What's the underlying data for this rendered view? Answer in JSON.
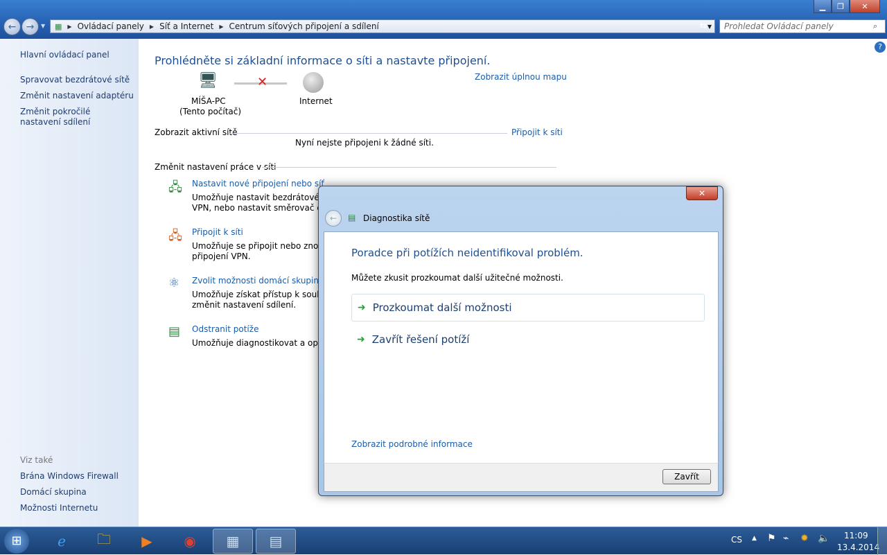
{
  "window": {
    "minimize": "▁",
    "maximize": "❐",
    "close": "✕"
  },
  "address": {
    "crumbs": [
      "Ovládací panely",
      "Síť a Internet",
      "Centrum síťových připojení a sdílení"
    ],
    "search_placeholder": "Prohledat Ovládací panely"
  },
  "sidebar": {
    "items": [
      "Hlavní ovládací panel",
      "Spravovat bezdrátové sítě",
      "Změnit nastavení adaptéru",
      "Změnit pokročilé nastavení sdílení"
    ],
    "see_also_title": "Viz také",
    "see_also": [
      "Brána Windows Firewall",
      "Domácí skupina",
      "Možnosti Internetu"
    ]
  },
  "main": {
    "title": "Prohlédněte si základní informace o síti a nastavte připojení.",
    "full_map": "Zobrazit úplnou mapu",
    "pc_name": "MÍŠA-PC",
    "pc_sub": "(Tento počítač)",
    "internet": "Internet",
    "active_title": "Zobrazit aktivní sítě",
    "connect": "Připojit k síti",
    "no_network": "Nyní nejste připojeni k žádné síti.",
    "change_title": "Změnit nastavení práce v síti",
    "tasks": [
      {
        "title": "Nastavit nové připojení nebo síť",
        "desc1": "Umožňuje nastavit bezdrátové, širo",
        "desc2": "VPN, nebo nastavit směrovač či přís"
      },
      {
        "title": "Připojit k síti",
        "desc1": "Umožňuje se připojit nebo znovu p",
        "desc2": "připojení VPN."
      },
      {
        "title": "Zvolit možnosti domácí skupiny a",
        "desc1": "Umožňuje získat přístup k souborů",
        "desc2": "změnit nastavení sdílení."
      },
      {
        "title": "Odstranit potíže",
        "desc1": "Umožňuje diagnostikovat a opravit",
        "desc2": ""
      }
    ]
  },
  "dialog": {
    "title": "Diagnostika sítě",
    "heading": "Poradce při potížích neidentifikoval problém.",
    "subtext": "Můžete zkusit prozkoumat další užitečné možnosti.",
    "options": [
      "Prozkoumat další možnosti",
      "Zavřít řešení potíží"
    ],
    "details_link": "Zobrazit podrobné informace",
    "close_button": "Zavřít",
    "close_x": "✕"
  },
  "taskbar": {
    "start": "⊞",
    "lang": "CS",
    "time": "11:09",
    "date": "13.4.2014"
  }
}
